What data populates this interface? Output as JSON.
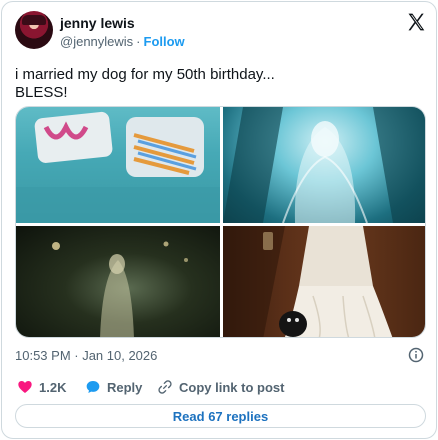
{
  "author": {
    "display_name": "jenny lewis",
    "handle": "@jennylewis",
    "separator": "·",
    "follow_label": "Follow"
  },
  "tweet": {
    "text": "i married my dog for my 50th birthday...\nBLESS!"
  },
  "meta": {
    "timestamp": "10:53 PM · Jan 10, 2026"
  },
  "actions": {
    "like_count": "1.2K",
    "reply_label": "Reply",
    "copy_link_label": "Copy link to post"
  },
  "read_replies_label": "Read 67 replies",
  "colors": {
    "accent": "#1d9bf0",
    "like": "#f91880",
    "text_secondary": "#536471",
    "border": "#cfd9de"
  },
  "icons": [
    "x-logo-icon",
    "info-icon",
    "heart-icon",
    "reply-bubble-icon",
    "link-icon"
  ]
}
